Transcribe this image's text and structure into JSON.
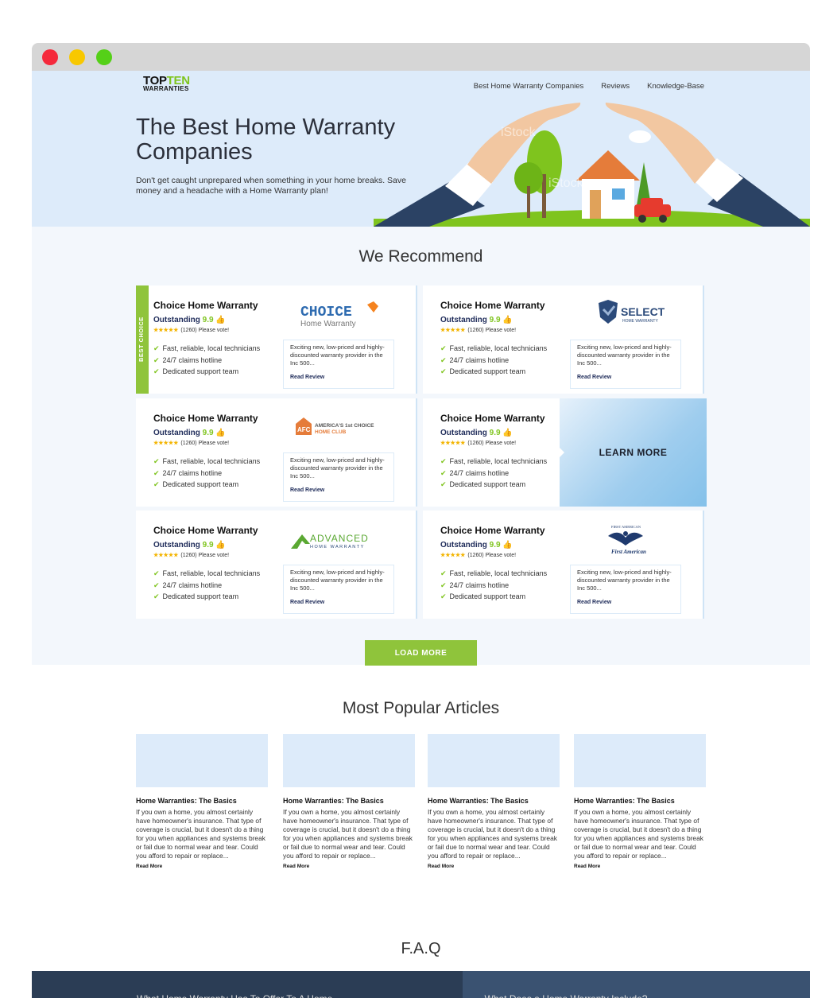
{
  "logo": {
    "top": "TOP",
    "ten": "TEN",
    "sub": "WARRANTIES"
  },
  "nav": [
    "Best Home Warranty Companies",
    "Reviews",
    "Knowledge-Base"
  ],
  "hero": {
    "title_bold": "The Best",
    "title_rest": " Home Warranty Companies",
    "subtitle": "Don't get caught unprepared when something in your home breaks. Save money and a headache with a Home Warranty plan!",
    "watermark": "iStock"
  },
  "recommend": {
    "title": "We Recommend",
    "best_label": "BEST CHOICE",
    "learn_more": "LEARN MORE",
    "load_more": "LOAD MORE",
    "cards": [
      {
        "name": "Choice Home Warranty",
        "rating_label": "Outstanding",
        "score": "9.9",
        "stars": "★★★★★",
        "votes": "(1260) Please vote!",
        "features": [
          "Fast, reliable, local technicians",
          "24/7 claims hotline",
          "Dedicated support team"
        ],
        "blurb": "Exciting new, low-priced and highly-discounted warranty provider in the Inc 500...",
        "read": "Read Review",
        "brand": "CHOICE",
        "brand_sub": "Home Warranty"
      },
      {
        "name": "Choice Home Warranty",
        "rating_label": "Outstanding",
        "score": "9.9",
        "stars": "★★★★★",
        "votes": "(1260) Please vote!",
        "features": [
          "Fast, reliable, local technicians",
          "24/7 claims hotline",
          "Dedicated support team"
        ],
        "blurb": "Exciting new, low-priced and highly-discounted warranty provider in the Inc 500...",
        "read": "Read Review",
        "brand": "SELECT",
        "brand_sub": "HOME WARRANTY"
      },
      {
        "name": "Choice Home Warranty",
        "rating_label": "Outstanding",
        "score": "9.9",
        "stars": "★★★★★",
        "votes": "(1260) Please vote!",
        "features": [
          "Fast, reliable, local technicians",
          "24/7 claims hotline",
          "Dedicated support team"
        ],
        "blurb": "Exciting new, low-priced and highly-discounted warranty provider in the Inc 500...",
        "read": "Read Review",
        "brand": "AMERICA'S 1st CHOICE",
        "brand_sub": "HOME CLUB"
      },
      {
        "name": "Choice Home Warranty",
        "rating_label": "Outstanding",
        "score": "9.9",
        "stars": "★★★★★",
        "votes": "(1260) Please vote!",
        "features": [
          "Fast, reliable, local technicians",
          "24/7 claims hotline",
          "Dedicated support team"
        ]
      },
      {
        "name": "Choice Home Warranty",
        "rating_label": "Outstanding",
        "score": "9.9",
        "stars": "★★★★★",
        "votes": "(1260) Please vote!",
        "features": [
          "Fast, reliable, local technicians",
          "24/7 claims hotline",
          "Dedicated support team"
        ],
        "blurb": "Exciting new, low-priced and highly-discounted warranty provider in the Inc 500...",
        "read": "Read Review",
        "brand": "ADVANCED",
        "brand_sub": "HOME WARRANTY"
      },
      {
        "name": "Choice Home Warranty",
        "rating_label": "Outstanding",
        "score": "9.9",
        "stars": "★★★★★",
        "votes": "(1260) Please vote!",
        "features": [
          "Fast, reliable, local technicians",
          "24/7 claims hotline",
          "Dedicated support team"
        ],
        "blurb": "Exciting new, low-priced and highly-discounted warranty provider in the Inc 500...",
        "read": "Read Review",
        "brand": "FIRST AMERICAN",
        "brand_sub": "First American"
      }
    ]
  },
  "articles": {
    "title": "Most Popular Articles",
    "items": [
      {
        "title": "Home Warranties: The Basics",
        "body": "If you own a home, you almost certainly have homeowner's insurance. That type of coverage is crucial, but it doesn't do a thing for you when appliances and systems break or fail due to normal wear and tear. Could you afford to repair or replace...",
        "more": "Read More"
      },
      {
        "title": "Home Warranties: The Basics",
        "body": "If you own a home, you almost certainly have homeowner's insurance. That type of coverage is crucial, but it doesn't do a thing for you when appliances and systems break or fail due to normal wear and tear. Could you afford to repair or replace...",
        "more": "Read More"
      },
      {
        "title": "Home Warranties: The Basics",
        "body": "If you own a home, you almost certainly have homeowner's insurance. That type of coverage is crucial, but it doesn't do a thing for you when appliances and systems break or fail due to normal wear and tear. Could you afford to repair or replace...",
        "more": "Read More"
      },
      {
        "title": "Home Warranties: The Basics",
        "body": "If you own a home, you almost certainly have homeowner's insurance. That type of coverage is crucial, but it doesn't do a thing for you when appliances and systems break or fail due to normal wear and tear. Could you afford to repair or replace...",
        "more": "Read More"
      }
    ]
  },
  "faq": {
    "title": "F.A.Q",
    "questions": [
      "What Home Warranty Has To Offer To A Home",
      "What Does a Home Warranty Include?"
    ]
  },
  "colors": {
    "accent_green": "#8fc43b",
    "hero_bg": "#ddebfa",
    "navy": "#1f2c5a",
    "faq_dark": "#2b3d55"
  }
}
